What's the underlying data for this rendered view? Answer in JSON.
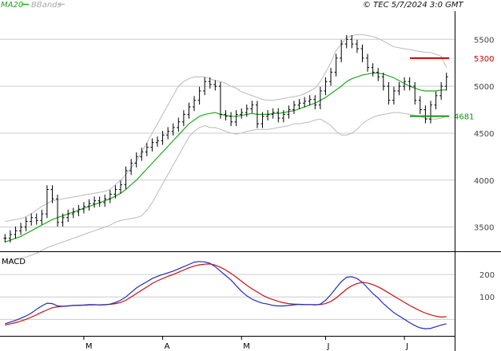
{
  "header": {
    "legend_ma": "MA20",
    "legend_bb": "BBands",
    "copyright": "© TEC 5/7/2024 3:0 GMT"
  },
  "colors": {
    "ma": "#22aa22",
    "bbands": "#bbbbbb",
    "price": "#000000",
    "resistance": "#cc0000",
    "support": "#119911",
    "macd": "#1f2fbf",
    "signal": "#cc1111",
    "grid": "#cccccc"
  },
  "chart_data": {
    "type": "line",
    "title": "",
    "price_panel": {
      "ylim": [
        3250,
        5800
      ],
      "y_ticks": [
        3500,
        4000,
        4500,
        5000,
        5500
      ],
      "y_tick_labels": [
        "3500",
        "4000",
        "4500",
        "5000",
        "5500"
      ],
      "close": [
        3380,
        3420,
        3460,
        3500,
        3560,
        3600,
        3570,
        3640,
        3900,
        3800,
        3550,
        3600,
        3640,
        3660,
        3690,
        3720,
        3750,
        3780,
        3760,
        3800,
        3850,
        3900,
        3950,
        4100,
        4180,
        4250,
        4300,
        4350,
        4400,
        4420,
        4480,
        4520,
        4560,
        4620,
        4700,
        4780,
        4850,
        4950,
        5050,
        5020,
        5000,
        4700,
        4680,
        4620,
        4700,
        4720,
        4760,
        4800,
        4600,
        4680,
        4700,
        4720,
        4660,
        4700,
        4750,
        4800,
        4820,
        4840,
        4860,
        4800,
        4950,
        5050,
        5150,
        5300,
        5450,
        5500,
        5450,
        5400,
        5300,
        5200,
        5150,
        5100,
        5000,
        4850,
        4950,
        5000,
        5050,
        5000,
        4850,
        4750,
        4650,
        4800,
        4900,
        5000,
        5100
      ],
      "ma20": [
        3340,
        3360,
        3380,
        3400,
        3430,
        3460,
        3490,
        3520,
        3550,
        3580,
        3600,
        3620,
        3640,
        3660,
        3680,
        3700,
        3720,
        3740,
        3760,
        3780,
        3800,
        3830,
        3860,
        3900,
        3950,
        4000,
        4060,
        4120,
        4180,
        4240,
        4300,
        4360,
        4420,
        4480,
        4540,
        4600,
        4640,
        4680,
        4700,
        4710,
        4720,
        4700,
        4690,
        4680,
        4680,
        4690,
        4700,
        4710,
        4700,
        4700,
        4700,
        4710,
        4710,
        4720,
        4730,
        4740,
        4760,
        4780,
        4800,
        4820,
        4850,
        4880,
        4920,
        4960,
        5000,
        5050,
        5080,
        5100,
        5120,
        5130,
        5140,
        5140,
        5130,
        5110,
        5090,
        5060,
        5030,
        5000,
        4980,
        4960,
        4950,
        4950,
        4950,
        4960,
        4960
      ],
      "bb_upper": [
        3560,
        3570,
        3580,
        3590,
        3610,
        3640,
        3680,
        3720,
        3750,
        3780,
        3790,
        3800,
        3810,
        3820,
        3830,
        3840,
        3850,
        3860,
        3870,
        3880,
        3900,
        3950,
        4000,
        4060,
        4130,
        4200,
        4300,
        4400,
        4500,
        4600,
        4700,
        4800,
        4900,
        5000,
        5050,
        5080,
        5100,
        5100,
        5100,
        5080,
        5060,
        5050,
        5030,
        5000,
        4980,
        4940,
        4920,
        4900,
        4880,
        4860,
        4850,
        4850,
        4860,
        4870,
        4880,
        4890,
        4900,
        4920,
        4950,
        4980,
        5050,
        5150,
        5250,
        5380,
        5450,
        5520,
        5540,
        5550,
        5550,
        5540,
        5530,
        5510,
        5480,
        5450,
        5420,
        5410,
        5400,
        5390,
        5380,
        5370,
        5360,
        5360,
        5340,
        5320,
        5200
      ],
      "bb_lower": [
        3120,
        3140,
        3160,
        3170,
        3180,
        3200,
        3220,
        3250,
        3280,
        3300,
        3320,
        3340,
        3360,
        3380,
        3400,
        3420,
        3440,
        3460,
        3480,
        3500,
        3520,
        3550,
        3570,
        3580,
        3590,
        3600,
        3620,
        3680,
        3760,
        3860,
        3960,
        4060,
        4160,
        4260,
        4360,
        4460,
        4520,
        4560,
        4580,
        4560,
        4560,
        4540,
        4520,
        4500,
        4490,
        4500,
        4520,
        4530,
        4540,
        4540,
        4540,
        4550,
        4560,
        4570,
        4580,
        4600,
        4600,
        4610,
        4620,
        4640,
        4650,
        4620,
        4580,
        4520,
        4480,
        4480,
        4500,
        4540,
        4600,
        4640,
        4670,
        4690,
        4700,
        4710,
        4720,
        4720,
        4710,
        4700,
        4690,
        4680,
        4660,
        4650,
        4650,
        4660,
        4680
      ],
      "levels": [
        {
          "label": "5300",
          "value": 5300,
          "kind": "resistance"
        },
        {
          "label": "4681",
          "value": 4681,
          "kind": "support"
        }
      ]
    },
    "macd_panel": {
      "label": "MACD",
      "ylim": [
        -70,
        300
      ],
      "y_ticks": [
        100,
        200
      ],
      "y_tick_labels": [
        "100",
        "200"
      ],
      "macd": [
        -20,
        -12,
        -5,
        5,
        15,
        28,
        45,
        60,
        72,
        70,
        60,
        58,
        60,
        62,
        63,
        64,
        66,
        66,
        64,
        65,
        68,
        75,
        85,
        100,
        120,
        140,
        155,
        168,
        182,
        192,
        200,
        208,
        215,
        225,
        235,
        245,
        255,
        258,
        256,
        250,
        235,
        215,
        195,
        175,
        150,
        125,
        105,
        90,
        80,
        72,
        68,
        62,
        60,
        60,
        62,
        65,
        67,
        66,
        66,
        64,
        68,
        85,
        110,
        140,
        168,
        188,
        190,
        182,
        165,
        140,
        115,
        95,
        70,
        50,
        30,
        15,
        0,
        -15,
        -28,
        -38,
        -42,
        -40,
        -33,
        -25,
        -20
      ],
      "signal": [
        -25,
        -20,
        -15,
        -8,
        0,
        10,
        20,
        32,
        42,
        52,
        56,
        58,
        60,
        62,
        62,
        63,
        64,
        65,
        65,
        66,
        67,
        70,
        75,
        85,
        100,
        115,
        130,
        145,
        160,
        172,
        182,
        192,
        200,
        210,
        220,
        230,
        238,
        243,
        246,
        247,
        242,
        232,
        220,
        205,
        188,
        170,
        152,
        136,
        122,
        108,
        96,
        88,
        80,
        74,
        70,
        68,
        67,
        66,
        66,
        66,
        66,
        70,
        80,
        95,
        115,
        135,
        150,
        160,
        165,
        162,
        155,
        145,
        132,
        118,
        104,
        90,
        76,
        62,
        50,
        38,
        28,
        20,
        14,
        10,
        12
      ]
    },
    "x_labels": [
      {
        "label": "M",
        "index": 15
      },
      {
        "label": "A",
        "index": 30
      },
      {
        "label": "M",
        "index": 45
      },
      {
        "label": "J",
        "index": 61
      },
      {
        "label": "J",
        "index": 76
      }
    ]
  }
}
